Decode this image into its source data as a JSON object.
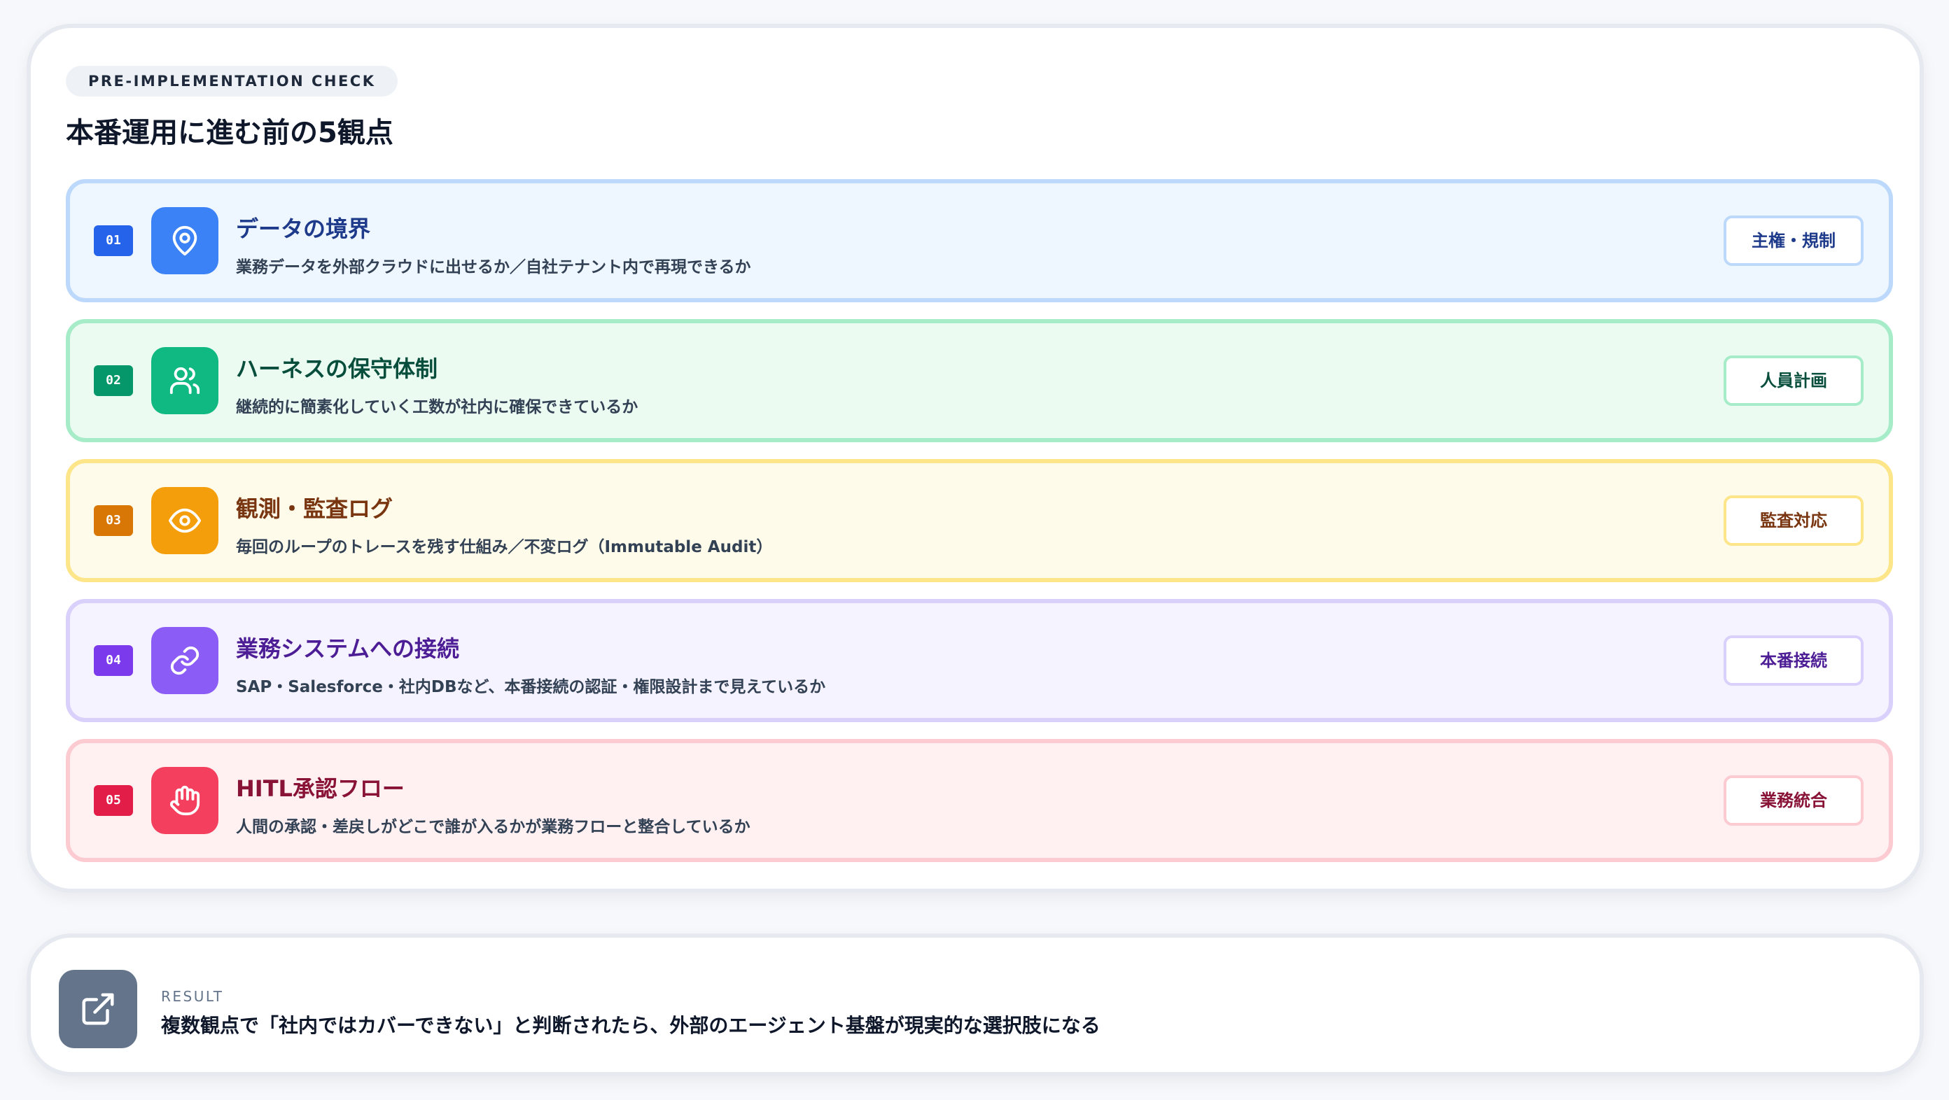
{
  "header": {
    "eyebrow": "PRE-IMPLEMENTATION CHECK",
    "title": "本番運用に進む前の5観点"
  },
  "checks": [
    {
      "number": "01",
      "icon": "map-pin-icon",
      "title": "データの境界",
      "description": "業務データを外部クラウドに出せるか／自社テナント内で再現できるか",
      "tag": "主権・規制",
      "colors": {
        "bg": "#eef6ff",
        "border": "#bcd9fb",
        "accent": "#2563eb",
        "icon": "#3b82f6",
        "title": "#1e3a8a"
      }
    },
    {
      "number": "02",
      "icon": "users-icon",
      "title": "ハーネスの保守体制",
      "description": "継続的に簡素化していく工数が社内に確保できているか",
      "tag": "人員計画",
      "colors": {
        "bg": "#ebfbf2",
        "border": "#a7ecc8",
        "accent": "#059669",
        "icon": "#10b981",
        "title": "#064e3b"
      }
    },
    {
      "number": "03",
      "icon": "eye-icon",
      "title": "観測・監査ログ",
      "description": "毎回のループのトレースを残す仕組み／不変ログ（Immutable Audit）",
      "tag": "監査対応",
      "colors": {
        "bg": "#fffbea",
        "border": "#fde58a",
        "accent": "#d97706",
        "icon": "#f59e0b",
        "title": "#78350f"
      }
    },
    {
      "number": "04",
      "icon": "link-icon",
      "title": "業務システムへの接続",
      "description": "SAP・Salesforce・社内DBなど、本番接続の認証・権限設計まで見えているか",
      "tag": "本番接続",
      "colors": {
        "bg": "#f5f3ff",
        "border": "#d9d0fb",
        "accent": "#7c3aed",
        "icon": "#8b5cf6",
        "title": "#4c1d95"
      }
    },
    {
      "number": "05",
      "icon": "hand-icon",
      "title": "HITL承認フロー",
      "description": "人間の承認・差戻しがどこで誰が入るかが業務フローと整合しているか",
      "tag": "業務統合",
      "colors": {
        "bg": "#fff1f2",
        "border": "#fbcbd1",
        "accent": "#e11d48",
        "icon": "#f43f5e",
        "title": "#881337"
      }
    }
  ],
  "result": {
    "icon": "external-link-icon",
    "label": "RESULT",
    "text": "複数観点で「社内ではカバーできない」と判断されたら、外部のエージェント基盤が現実的な選択肢になる"
  }
}
